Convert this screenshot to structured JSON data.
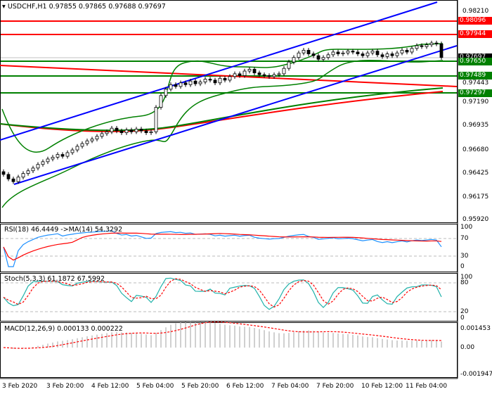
{
  "header": {
    "symbol": "USDCHF,H1",
    "ohlc": "0.97855 0.97865 0.97688 0.97697"
  },
  "price_scale": [
    "0.98210",
    "0.97190",
    "0.96935",
    "0.96680",
    "0.96425",
    "0.96175",
    "0.95920"
  ],
  "levels": [
    {
      "value": "0.98096",
      "color": "#ff0000"
    },
    {
      "value": "0.97944",
      "color": "#ff0000"
    },
    {
      "value": "0.97650",
      "color": "#008000"
    },
    {
      "value": "0.97489",
      "color": "#008000"
    },
    {
      "value": "0.97297",
      "color": "#008000"
    }
  ],
  "current_price": "0.97697",
  "hidden_price": "0.97443",
  "rsi": {
    "label": "RSI(18) 46.4449  ->MA(14) 54.3292",
    "ticks": [
      "100",
      "70",
      "30",
      "0"
    ]
  },
  "stoch": {
    "label": "Stoch(5,3,3) 61.1872 67.5992",
    "ticks": [
      "100",
      "80",
      "20",
      "0"
    ]
  },
  "macd": {
    "label": "MACD(12,26,9) 0.000133 0.000222",
    "ticks": [
      "0.001453",
      "0.00",
      "-0.001947"
    ]
  },
  "time_axis": [
    "3 Feb 2020",
    "3 Feb 20:00",
    "4 Feb 12:00",
    "5 Feb 04:00",
    "5 Feb 20:00",
    "6 Feb 12:00",
    "7 Feb 04:00",
    "7 Feb 20:00",
    "10 Feb 12:00",
    "11 Feb 04:00"
  ],
  "chart_data": {
    "type": "candlestick",
    "title": "USDCHF,H1",
    "ylim": [
      0.9592,
      0.9821
    ],
    "closes": [
      0.9641,
      0.9636,
      0.9633,
      0.9638,
      0.9642,
      0.9645,
      0.9648,
      0.9652,
      0.9655,
      0.9658,
      0.966,
      0.9663,
      0.9661,
      0.9665,
      0.9668,
      0.9672,
      0.9675,
      0.9678,
      0.968,
      0.9683,
      0.9686,
      0.9688,
      0.9692,
      0.9689,
      0.9687,
      0.969,
      0.9688,
      0.9691,
      0.9689,
      0.9687,
      0.9688,
      0.9715,
      0.9728,
      0.9735,
      0.974,
      0.9738,
      0.9742,
      0.974,
      0.9744,
      0.9741,
      0.9743,
      0.9746,
      0.9745,
      0.9742,
      0.9747,
      0.9745,
      0.9749,
      0.9752,
      0.975,
      0.9755,
      0.9757,
      0.9753,
      0.9751,
      0.975,
      0.9749,
      0.9751,
      0.9752,
      0.9758,
      0.9765,
      0.977,
      0.9775,
      0.9778,
      0.9774,
      0.9772,
      0.9768,
      0.977,
      0.9773,
      0.9776,
      0.9774,
      0.9775,
      0.9777,
      0.9776,
      0.9774,
      0.9772,
      0.9775,
      0.9777,
      0.9773,
      0.9771,
      0.9774,
      0.9772,
      0.9775,
      0.9778,
      0.9776,
      0.978,
      0.9783,
      0.9782,
      0.9784,
      0.9786,
      0.9785,
      0.977
    ],
    "colors": {
      "up": "#ffffff",
      "down": "#000000",
      "rsi": "#1e90ff",
      "rsi_ma": "#ff0000",
      "stoch_k": "#20b2aa",
      "stoch_d": "#ff0000",
      "macd_hist": "#a0a0a0",
      "macd_signal": "#ff0000",
      "channel": "#0000ff",
      "bands": "#008000"
    }
  }
}
